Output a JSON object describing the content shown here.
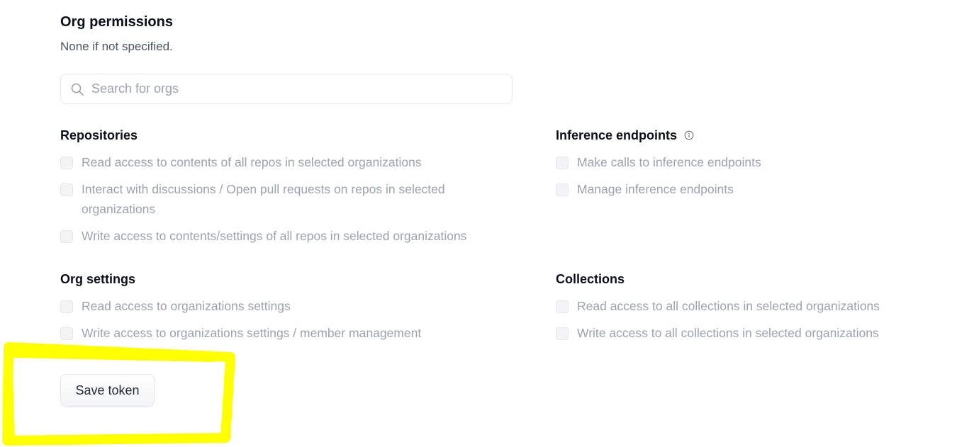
{
  "org_permissions": {
    "title": "Org permissions",
    "subtitle": "None if not specified.",
    "search": {
      "placeholder": "Search for orgs",
      "value": ""
    }
  },
  "groups": {
    "repositories": {
      "title": "Repositories",
      "options": [
        "Read access to contents of all repos in selected organizations",
        "Interact with discussions / Open pull requests on repos in selected organizations",
        "Write access to contents/settings of all repos in selected organizations"
      ]
    },
    "inference_endpoints": {
      "title": "Inference endpoints",
      "options": [
        "Make calls to inference endpoints",
        "Manage inference endpoints"
      ]
    },
    "org_settings": {
      "title": "Org settings",
      "options": [
        "Read access to organizations settings",
        "Write access to organizations settings / member management"
      ]
    },
    "collections": {
      "title": "Collections",
      "options": [
        "Read access to all collections in selected organizations",
        "Write access to all collections in selected organizations"
      ]
    }
  },
  "actions": {
    "save_label": "Save token"
  },
  "colors": {
    "highlight": "#ffff00",
    "disabled_text": "#9ca3af"
  },
  "icons": {
    "search": "search-icon",
    "info": "info-icon"
  }
}
